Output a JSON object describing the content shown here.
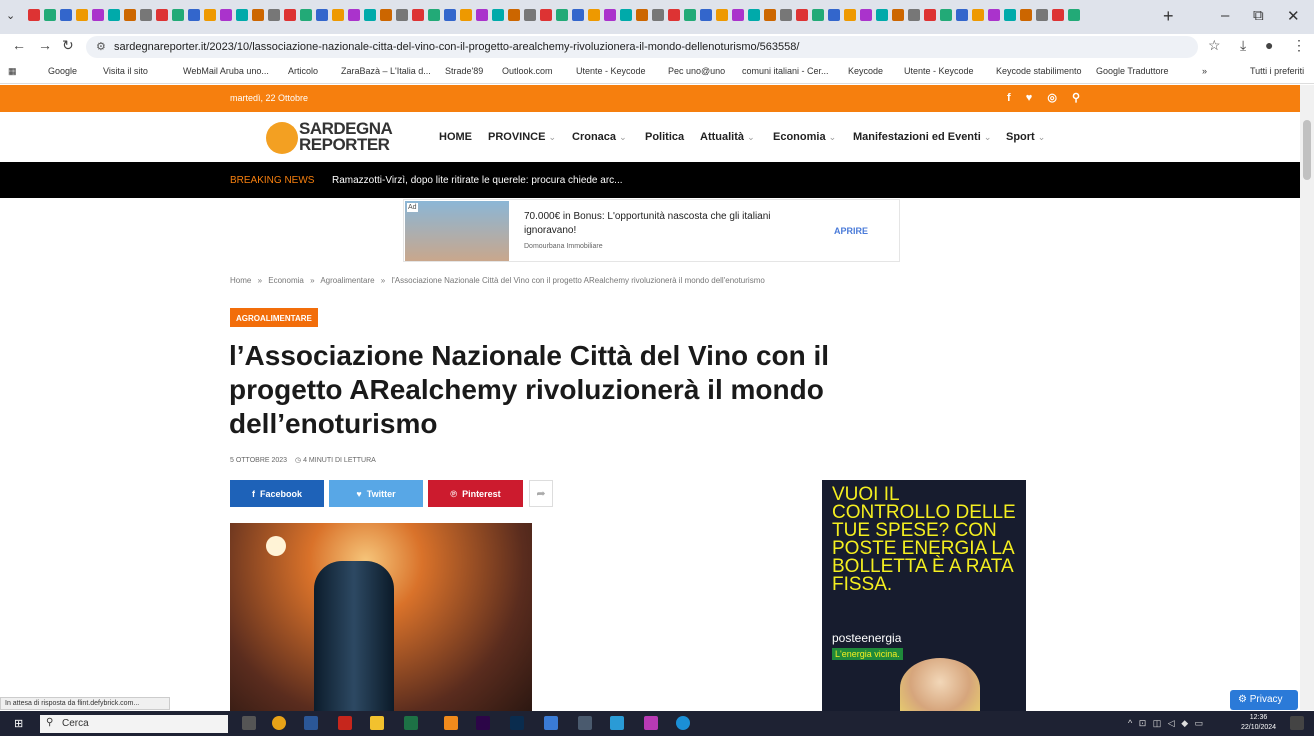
{
  "browser": {
    "url": "sardegnareporter.it/2023/10/lassociazione-nazionale-citta-del-vino-con-il-progetto-arealchemy-rivoluzionera-il-mondo-dellenoturismo/563558/",
    "bookmarks": [
      "Google",
      "Visita il sito",
      "WebMail Aruba uno...",
      "Articolo",
      "ZaraBazà – L'Italia d...",
      "Strade'89",
      "Outlook.com",
      "Utente - Keycode",
      "Pec uno@uno",
      "comuni italiani - Cer...",
      "Keycode",
      "Utente - Keycode",
      "Keycode stabilimento",
      "Google Traduttore"
    ],
    "bookmarks_more": "»",
    "all_bookmarks": "Tutti i preferiti",
    "status_text": "In attesa di risposta da flint.defybrick.com..."
  },
  "site": {
    "date": "martedì, 22 Ottobre",
    "logo_line1": "SARDEGNA",
    "logo_line2": "REPORTER",
    "menu": [
      "HOME",
      "PROVINCE",
      "Cronaca",
      "Politica",
      "Attualità",
      "Economia",
      "Manifestazioni ed Eventi",
      "Sport"
    ],
    "breaking_label": "BREAKING NEWS",
    "breaking_text": "Ramazzotti-Virzì, dopo lite ritirate le querele: procura chiede arc..."
  },
  "ad": {
    "tag": "Ad",
    "title": "70.000€ in Bonus: L'opportunità nascosta che gli italiani ignoravano!",
    "sponsor": "Domourbana Immobiliare",
    "cta": "APRIRE"
  },
  "article": {
    "breadcrumb": [
      "Home",
      "Economia",
      "Agroalimentare",
      "l'Associazione Nazionale Città del Vino con il progetto ARealchemy rivoluzionerà il mondo dell'enoturismo"
    ],
    "category": "AGROALIMENTARE",
    "title": "l’Associazione Nazionale Città del Vino con il progetto ARealchemy rivoluzionerà il mondo dell’enoturismo",
    "date": "5 OTTOBRE 2023",
    "read_time": "4 MINUTI DI LETTURA",
    "share": [
      "Facebook",
      "Twitter",
      "Pinterest"
    ]
  },
  "side_ad": {
    "headline": "VUOI IL CONTROLLO DELLE TUE SPESE? CON POSTE ENERGIA LA BOLLETTA È A RATA FISSA.",
    "brand": "posteenergia",
    "claim": "L'energia vicina."
  },
  "privacy": "Privacy",
  "taskbar": {
    "search": "Cerca",
    "time": "12:36",
    "date": "22/10/2024"
  }
}
